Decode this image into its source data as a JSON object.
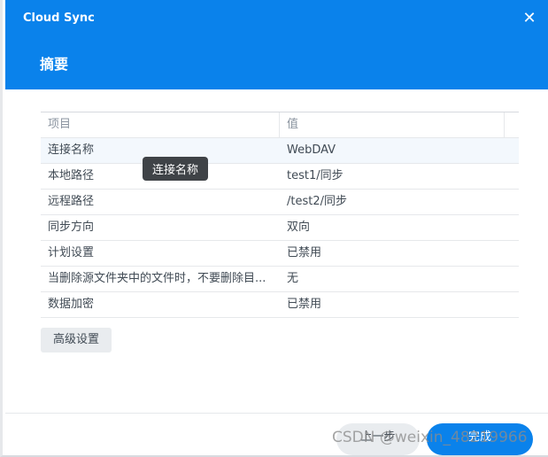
{
  "window": {
    "app_title": "Cloud Sync",
    "close_glyph": "✕"
  },
  "step": {
    "title": "摘要"
  },
  "table": {
    "columns": [
      "项目",
      "值"
    ],
    "rows": [
      {
        "item": "连接名称",
        "value": "WebDAV"
      },
      {
        "item": "本地路径",
        "value": "test1/同步"
      },
      {
        "item": "远程路径",
        "value": "/test2/同步"
      },
      {
        "item": "同步方向",
        "value": "双向"
      },
      {
        "item": "计划设置",
        "value": "已禁用"
      },
      {
        "item": "当删除源文件夹中的文件时，不要删除目...",
        "value": "无"
      },
      {
        "item": "数据加密",
        "value": "已禁用"
      }
    ]
  },
  "tooltip": {
    "text": "连接名称"
  },
  "buttons": {
    "advanced": "高级设置",
    "prev": "上一步",
    "done": "完成"
  },
  "watermark": "CSDN @weixin_48219966",
  "colors": {
    "header": "#0a82eb",
    "primary_button": "#0a82eb",
    "secondary_button": "#e9ecef"
  }
}
